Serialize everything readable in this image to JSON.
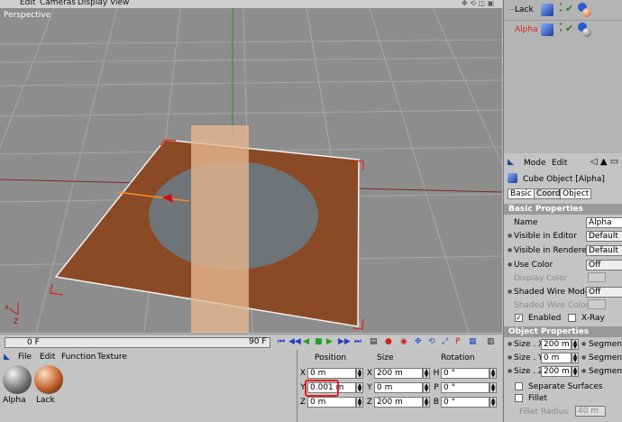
{
  "viewport_menu": [
    "Edit",
    "Cameras",
    "Display",
    "View"
  ],
  "viewport_label": "Perspective",
  "timeline": {
    "current_frame": "0 F",
    "end_frame": "90 F"
  },
  "material_manager": {
    "menu": [
      "File",
      "Edit",
      "Function",
      "Texture"
    ],
    "materials": [
      {
        "name": "Alpha"
      },
      {
        "name": "Lack"
      }
    ]
  },
  "coordinates": {
    "headers": {
      "position": "Position",
      "size": "Size",
      "rotation": "Rotation"
    },
    "rows": [
      {
        "pos_axis": "X",
        "pos": "0 m",
        "size_axis": "X",
        "size": "200 m",
        "rot_axis": "H",
        "rot": "0 °"
      },
      {
        "pos_axis": "Y",
        "pos": "0.001 m",
        "size_axis": "Y",
        "size": "0 m",
        "rot_axis": "P",
        "rot": "0 °"
      },
      {
        "pos_axis": "Z",
        "pos": "0 m",
        "size_axis": "Z",
        "size": "200 m",
        "rot_axis": "B",
        "rot": "0 °"
      }
    ]
  },
  "object_manager": {
    "objects": [
      {
        "name": "Lack"
      },
      {
        "name": "Alpha"
      }
    ]
  },
  "attributes": {
    "menu": [
      "Mode",
      "Edit"
    ],
    "object_title": "Cube Object [Alpha]",
    "tabs": [
      "Basic",
      "Coord.",
      "Object"
    ],
    "basic_header": "Basic Properties",
    "props": [
      {
        "label": "Name",
        "value": "Alpha"
      },
      {
        "label": "Visible in Editor",
        "value": "Default"
      },
      {
        "label": "Visible in Renderer",
        "value": "Default"
      },
      {
        "label": "Use Color",
        "value": "Off"
      },
      {
        "label": "Display Color",
        "value": ""
      },
      {
        "label": "Shaded Wire Mode",
        "value": "Off"
      },
      {
        "label": "Shaded Wire Color",
        "value": ""
      }
    ],
    "enabled_label": "Enabled",
    "xray_label": "X-Ray",
    "object_header": "Object Properties",
    "size_rows": [
      {
        "label": "Size . X",
        "value": "200 m",
        "seg": "Segment"
      },
      {
        "label": "Size . Y",
        "value": "0 m",
        "seg": "Segment"
      },
      {
        "label": "Size . Z",
        "value": "200 m",
        "seg": "Segment"
      }
    ],
    "separate_surfaces": "Separate Surfaces",
    "fillet": "Fillet",
    "fillet_radius": "Fillet Radius",
    "fillet_radius_value": "40 m"
  },
  "colors": {
    "accent_red": "#e02020",
    "plane": "#8a4a26",
    "disc": "#6f7478",
    "column": "#e8b890"
  }
}
